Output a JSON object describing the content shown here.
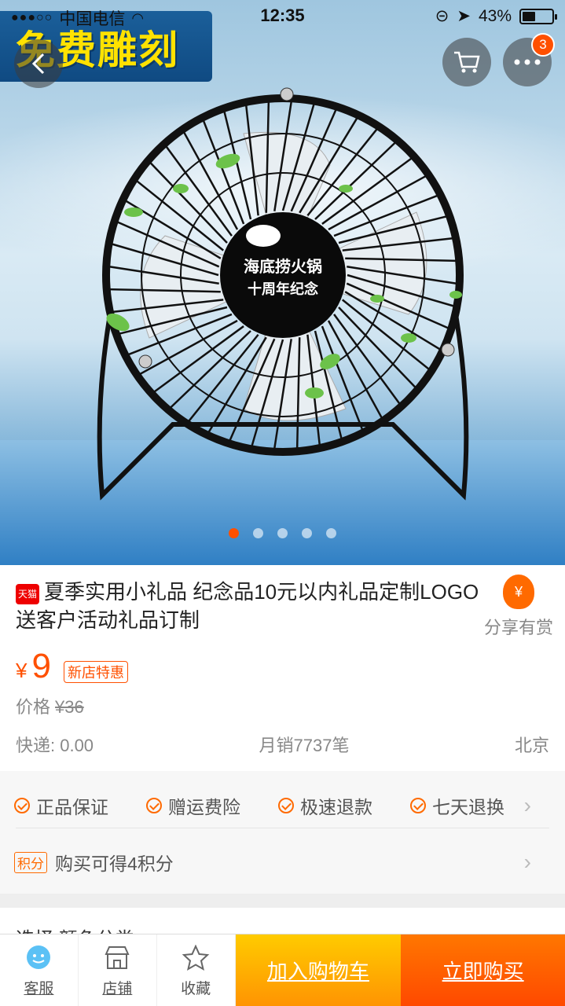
{
  "status_bar": {
    "signal": "●●●○○",
    "carrier": "中国电信",
    "time": "12:35",
    "battery": "43%"
  },
  "hero": {
    "promo_text": "免费雕刻",
    "more_badge": "3",
    "fan_logo_line1": "海底捞火锅",
    "fan_logo_line2": "十周年纪念",
    "carousel_count": 5,
    "carousel_active": 0
  },
  "product": {
    "store_tag": "天猫",
    "title": "夏季实用小礼品 纪念品10元以内礼品定制LOGO送客户活动礼品订制",
    "share_label": "分享有赏",
    "currency": "¥",
    "price": "9",
    "promo_tag": "新店特惠",
    "orig_label": "价格",
    "orig_price": "¥36",
    "shipping": "快递: 0.00",
    "monthly_sales": "月销7737笔",
    "location": "北京"
  },
  "services": {
    "items": [
      "正品保证",
      "赠运费险",
      "极速退款",
      "七天退换"
    ],
    "points_tag": "积分",
    "points_text": "购买可得4积分"
  },
  "select_row": {
    "label": "选择 颜色分类"
  },
  "bottom_bar": {
    "service_label": "客服",
    "store_label": "店铺",
    "favorite_label": "收藏",
    "add_cart_label": "加入购物车",
    "buy_now_label": "立即购买"
  },
  "colors": {
    "accent": "#ff5000",
    "cart_button": "#ffb400",
    "buy_button": "#ff5a00"
  }
}
